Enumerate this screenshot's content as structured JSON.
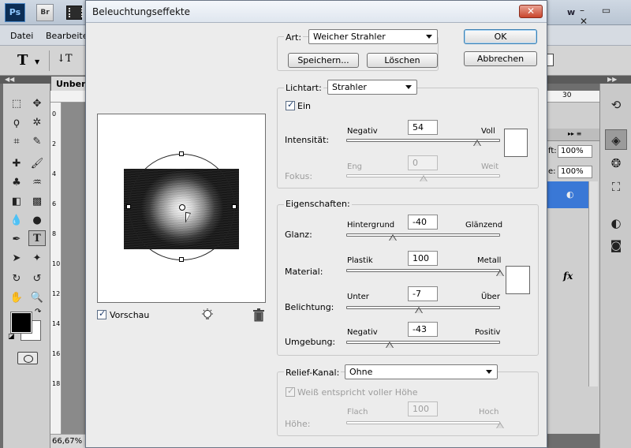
{
  "app": {
    "logo": "Ps",
    "bridge": "Br",
    "workspace_letter": "w",
    "window_controls": "– ▭ ✕",
    "menu": [
      "Datei",
      "Bearbeite"
    ],
    "doc_tab": "Unben",
    "zoom": "66,67%",
    "ruler_ticks": [
      "0",
      "2",
      "4",
      "6",
      "8",
      "10",
      "12",
      "14",
      "16",
      "18"
    ],
    "right_ruler_tick": "30",
    "opacity_label": "ft:",
    "opacity_value": "100%",
    "fill_label": "e:",
    "fill_value": "100%",
    "fx": "fx"
  },
  "dialog": {
    "title": "Beleuchtungseffekte",
    "close": "✕",
    "ok": "OK",
    "cancel": "Abbrechen",
    "preview_label": "Vorschau",
    "preview_checked": true,
    "style": {
      "label": "Art:",
      "value": "Weicher Strahler",
      "save": "Speichern...",
      "delete": "Löschen"
    },
    "light_type": {
      "label": "Lichtart:",
      "value": "Strahler",
      "on_label": "Ein",
      "on_checked": true,
      "intensity": {
        "label": "Intensität:",
        "left": "Negativ",
        "right": "Voll",
        "value": "54",
        "pos": 0.85
      },
      "focus": {
        "label": "Fokus:",
        "left": "Eng",
        "right": "Weit",
        "value": "0",
        "pos": 0.5,
        "disabled": true
      },
      "color": "#ffffff"
    },
    "properties": {
      "label": "Eigenschaften:",
      "gloss": {
        "label": "Glanz:",
        "left": "Hintergrund",
        "right": "Glänzend",
        "value": "-40",
        "pos": 0.3
      },
      "material": {
        "label": "Material:",
        "left": "Plastik",
        "right": "Metall",
        "value": "100",
        "pos": 1.0
      },
      "exposure": {
        "label": "Belichtung:",
        "left": "Unter",
        "right": "Über",
        "value": "-7",
        "pos": 0.47
      },
      "ambience": {
        "label": "Umgebung:",
        "left": "Negativ",
        "right": "Positiv",
        "value": "-43",
        "pos": 0.28
      },
      "color": "#ffffff"
    },
    "texture": {
      "label": "Relief-Kanal:",
      "value": "Ohne",
      "white_high_label": "Weiß entspricht voller Höhe",
      "white_high_checked": true,
      "height": {
        "label": "Höhe:",
        "left": "Flach",
        "right": "Hoch",
        "value": "100",
        "pos": 1.0,
        "disabled": true
      }
    }
  }
}
